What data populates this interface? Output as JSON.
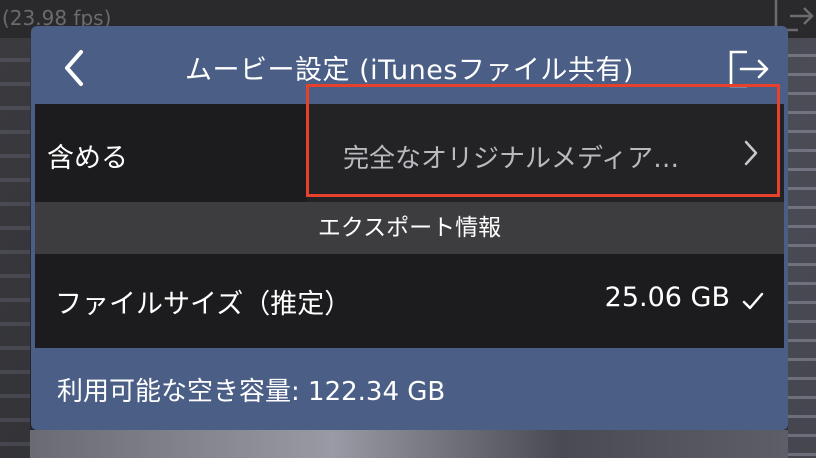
{
  "background": {
    "fps_text": "(23.98 fps)"
  },
  "dialog": {
    "title": "ムービー設定 (iTunesファイル共有)",
    "include": {
      "label": "含める",
      "value": "完全なオリジナルメディア…"
    },
    "section_header": "エクスポート情報",
    "file_size": {
      "label": "ファイルサイズ（推定）",
      "value": "25.06 GB"
    },
    "available_space": "利用可能な空き容量: 122.34 GB"
  },
  "colors": {
    "panel": "#4b5e86",
    "row_bg": "#1c1c1e",
    "section_bg": "#3d3d40",
    "highlight": "#e8412b"
  },
  "icons": [
    "back-chevron-icon",
    "export-icon",
    "chevron-right-icon",
    "checkmark-icon"
  ]
}
